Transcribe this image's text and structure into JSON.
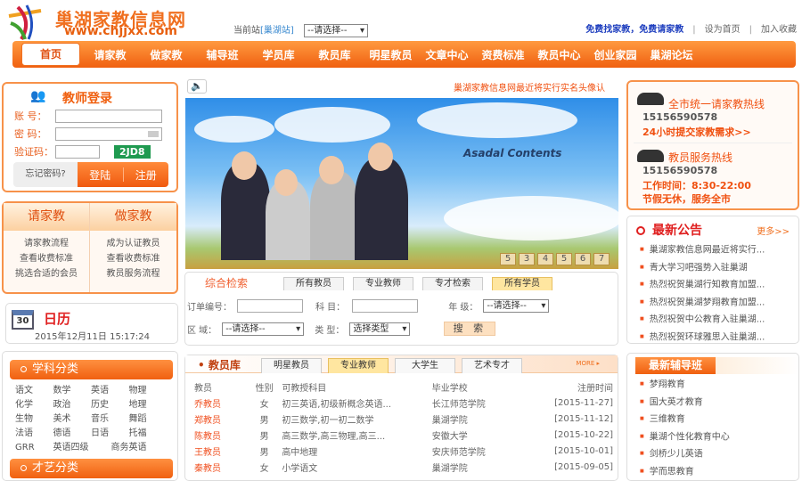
{
  "header": {
    "logo_title": "巢湖家教信息网",
    "logo_url": "www.chjjxx.com",
    "station_label": "当前站",
    "station_name": "[巢湖站]",
    "station_select": "--请选择--",
    "slogan": "免费找家教，免费请家教",
    "set_home": "设为首页",
    "add_fav": "加入收藏"
  },
  "nav": [
    "首页",
    "请家教",
    "做家教",
    "辅导班",
    "学员库",
    "教员库",
    "明星教员",
    "文章中心",
    "资费标准",
    "教员中心",
    "创业家园",
    "巢湖论坛"
  ],
  "login": {
    "title": "教师登录",
    "account_label": "账 号：",
    "password_label": "密 码：",
    "captcha_label": "验证码：",
    "captcha_code": "2JD8",
    "forgot": "忘记密码?",
    "login_btn": "登陆",
    "register_btn": "注册"
  },
  "qj": {
    "left_title": "请家教",
    "left_links": [
      "请家教流程",
      "查看收费标准",
      "挑选合适的会员"
    ],
    "right_title": "做家教",
    "right_links": [
      "成为认证教员",
      "查看收费标准",
      "教员服务流程"
    ]
  },
  "calendar": {
    "icon_day": "30",
    "title": "日历",
    "datetime": "2015年12月11日  15:17:24"
  },
  "subjects": {
    "title": "学科分类",
    "items": [
      "语文",
      "数学",
      "英语",
      "物理",
      "化学",
      "政治",
      "历史",
      "地理",
      "生物",
      "美术",
      "音乐",
      "舞蹈",
      "法语",
      "德语",
      "日语",
      "托福"
    ],
    "extra": [
      "GRR",
      "英语四级",
      "商务英语"
    ],
    "art_title": "才艺分类"
  },
  "notice": {
    "marquee": "巢湖家教信息网最近将实行实名头像认"
  },
  "banner": {
    "brand": "Asadal Contents",
    "pages": [
      "5",
      "3",
      "4",
      "5",
      "6",
      "7"
    ]
  },
  "search": {
    "title": "综合检索",
    "tabs": [
      "所有教员",
      "专业教师",
      "专才检索",
      "所有学员"
    ],
    "order_label": "订单编号：",
    "subject_label": "科 目：",
    "grade_label": "年 级：",
    "grade_select": "--请选择--",
    "area_label": "区 域：",
    "area_select": "--请选择--",
    "type_label": "类 型：",
    "type_select": "选择类型",
    "search_btn": "搜 索"
  },
  "teachers": {
    "title": "教员库",
    "tabs": [
      "明星教员",
      "专业教师",
      "大学生",
      "艺术专才"
    ],
    "more": "MORE ▸",
    "headers": [
      "教员",
      "性别",
      "可教授科目",
      "毕业学校",
      "注册时间"
    ],
    "rows": [
      [
        "乔教员",
        "女",
        "初三英语,初级新概念英语...",
        "长江师范学院",
        "[2015-11-27]"
      ],
      [
        "郑教员",
        "男",
        "初三数学,初一初二数学",
        "巢湖学院",
        "[2015-11-12]"
      ],
      [
        "陈教员",
        "男",
        "高三数学,高三物理,高三...",
        "安徽大学",
        "[2015-10-22]"
      ],
      [
        "王教员",
        "男",
        "高中地理",
        "安庆师范学院",
        "[2015-10-01]"
      ],
      [
        "秦教员",
        "女",
        "小学语文",
        "巢湖学院",
        "[2015-09-05]"
      ]
    ]
  },
  "hotline": {
    "title1": "全市统一请家教热线",
    "phone1": "15156590578",
    "line1": "24小时提交家教需求>>",
    "title2": "教员服务热线",
    "phone2": "15156590578",
    "hours": "工作时间：8:30-22:00",
    "line2": "节假无休，服务全市"
  },
  "announcements": {
    "title": "最新公告",
    "more": "更多>>",
    "items": [
      "巢湖家教信息网最近将实行...",
      "青大学习吧强势入驻巢湖",
      "热烈祝贺巢湖行知教育加盟...",
      "热烈祝贺巢湖梦翔教育加盟...",
      "热烈祝贺中公教育入驻巢湖...",
      "热烈祝贺环球雅思入驻巢湖..."
    ]
  },
  "classes": {
    "title": "最新辅导班",
    "items": [
      "梦翔教育",
      "国大英才教育",
      "三维教育",
      "巢湖个性化教育中心",
      "剑桥少儿英语",
      "学而思教育"
    ]
  }
}
